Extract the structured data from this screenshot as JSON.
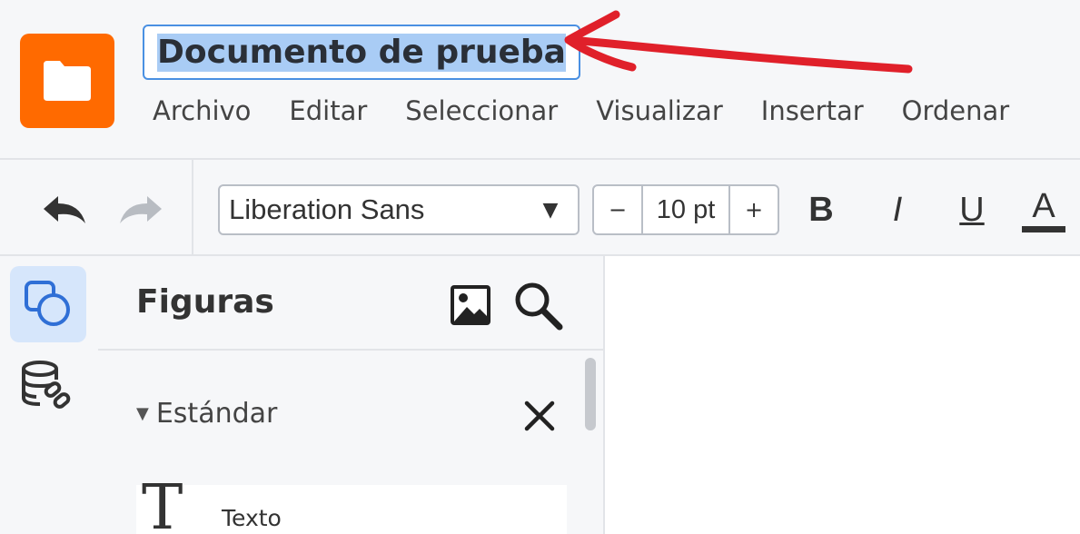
{
  "header": {
    "document_title": "Documento de prueba",
    "app_icon": "folder-icon",
    "brand_color": "#ff6a00",
    "menu": [
      "Archivo",
      "Editar",
      "Seleccionar",
      "Visualizar",
      "Insertar",
      "Ordenar"
    ]
  },
  "toolbar": {
    "undo_icon": "undo-icon",
    "redo_icon": "redo-icon",
    "font_family": "Liberation Sans",
    "font_size": "10 pt",
    "size_minus": "−",
    "size_plus": "+",
    "bold": "B",
    "italic": "I",
    "underline": "U",
    "font_color": "A"
  },
  "rail": {
    "items": [
      {
        "icon": "shapes-icon",
        "active": true
      },
      {
        "icon": "database-link-icon",
        "active": false
      }
    ]
  },
  "panel": {
    "title": "Figuras",
    "section": {
      "label": "Estándar",
      "expanded": true
    },
    "shapes": [
      {
        "glyph": "T",
        "label": "Texto"
      }
    ]
  },
  "annotation": {
    "color": "#e0202a",
    "icon": "arrow-annotation"
  },
  "colors": {
    "selection": "#a9ccf5",
    "focus_border": "#4a90e2",
    "rail_active": "#d6e6fb",
    "shapes_icon": "#2f6fd6"
  }
}
